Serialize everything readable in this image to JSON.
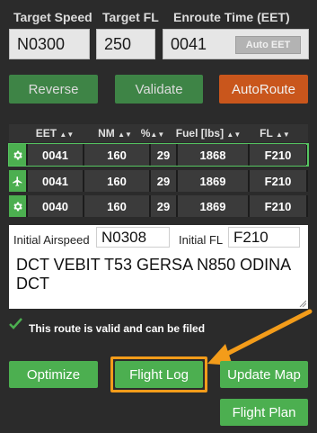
{
  "header": {
    "target_speed_label": "Target Speed",
    "target_fl_label": "Target FL",
    "eet_label": "Enroute Time (EET)",
    "target_speed_value": "N0300",
    "target_fl_value": "250",
    "eet_value": "0041",
    "auto_eet_label": "Auto EET"
  },
  "actions": {
    "reverse_label": "Reverse",
    "validate_label": "Validate",
    "autoroute_label": "AutoRoute"
  },
  "table": {
    "columns": [
      "EET",
      "NM",
      "%",
      "Fuel [lbs]",
      "FL"
    ],
    "rows": [
      {
        "icon": "gear-icon",
        "eet": "0041",
        "nm": "160",
        "pct": "29",
        "fuel": "1868",
        "fl": "F210",
        "selected": true
      },
      {
        "icon": "plane-icon",
        "eet": "0041",
        "nm": "160",
        "pct": "29",
        "fuel": "1869",
        "fl": "F210",
        "selected": false
      },
      {
        "icon": "gear-icon",
        "eet": "0040",
        "nm": "160",
        "pct": "29",
        "fuel": "1869",
        "fl": "F210",
        "selected": false
      }
    ]
  },
  "route": {
    "initial_airspeed_label": "Initial Airspeed",
    "initial_airspeed_value": "N0308",
    "initial_fl_label": "Initial FL",
    "initial_fl_value": "F210",
    "route_line1": "DCT VEBIT T53 GERSA N850 ODINA",
    "route_line2": "DCT"
  },
  "status": {
    "valid_text": "This route is valid and can be filed"
  },
  "buttons": {
    "optimize_label": "Optimize",
    "flight_log_label": "Flight Log",
    "update_map_label": "Update Map",
    "flight_plan_label": "Flight Plan"
  },
  "colors": {
    "background": "#2b2b2b",
    "green": "#4caf50",
    "dark_green": "#3e8446",
    "orange": "#c9561c",
    "highlight": "#f39c1a"
  }
}
